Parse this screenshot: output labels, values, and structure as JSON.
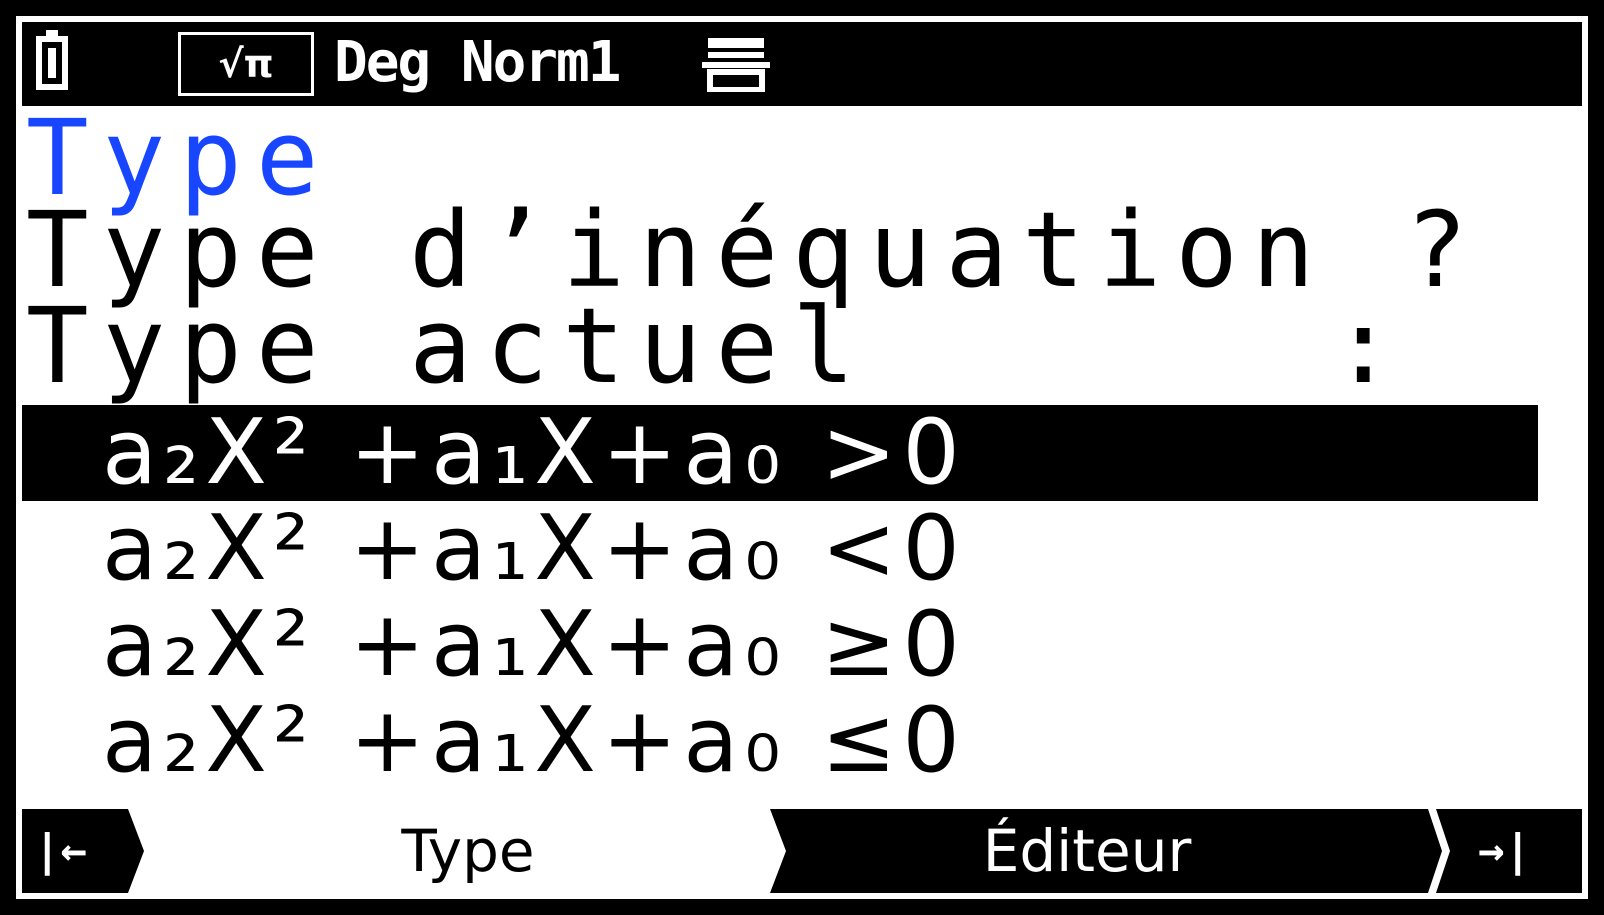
{
  "status": {
    "battery_icon": "battery-full-icon",
    "mode_label": "√π",
    "angle_format": "Deg Norm1",
    "keyboard_icon": "keyboard-icon"
  },
  "screen": {
    "title": "Type",
    "question": "Type d’inéquation ?",
    "current_label": "Type actuel",
    "current_colon": ":"
  },
  "options": [
    {
      "label": "a₂X² +a₁X+a₀ >0",
      "selected": true
    },
    {
      "label": "a₂X² +a₁X+a₀ <0",
      "selected": false
    },
    {
      "label": "a₂X² +a₁X+a₀ ≥0",
      "selected": false
    },
    {
      "label": "a₂X² +a₁X+a₀ ≤0",
      "selected": false
    }
  ],
  "bottom_bar": {
    "nav_left": "|←",
    "tab_type": "Type",
    "tab_editor": "Éditeur",
    "nav_right": "→|"
  },
  "colors": {
    "title": "#1846ff",
    "background": "#ffffff",
    "foreground": "#000000"
  }
}
